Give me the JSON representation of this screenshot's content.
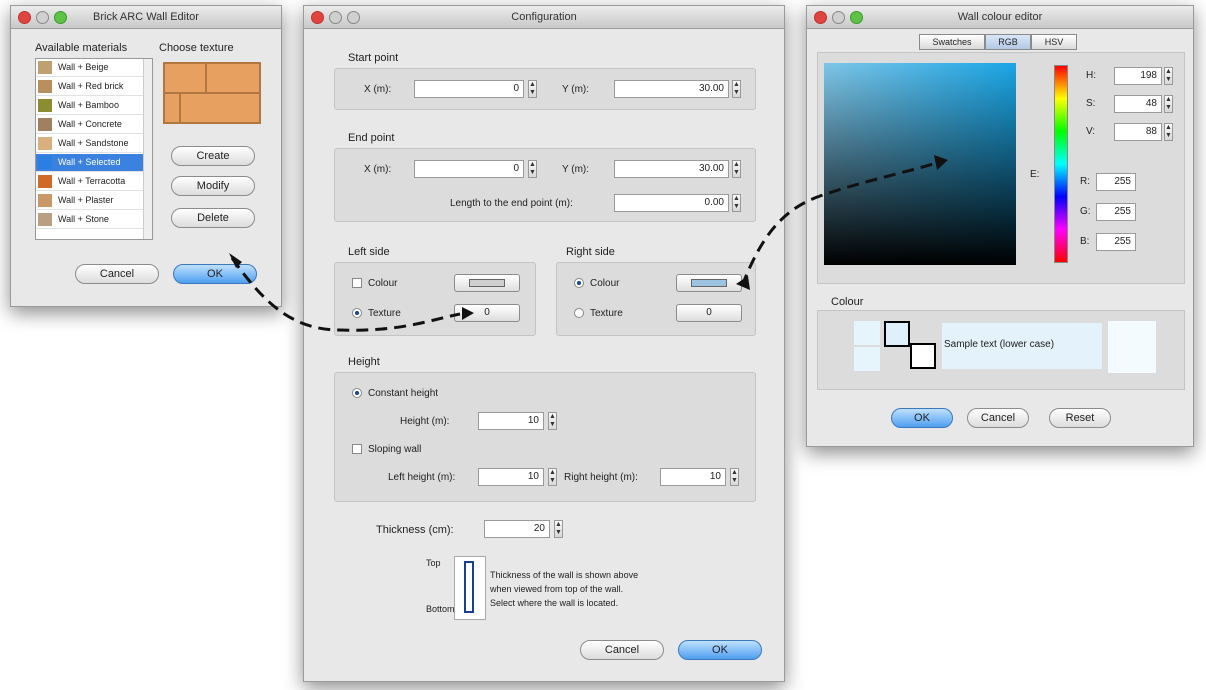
{
  "windows": {
    "left": {
      "title": "Brick ARC Wall Editor",
      "list_header": "Available materials",
      "preview_header": "Choose texture",
      "rows": [
        {
          "label": "Wall + Beige",
          "color": "#c0a070"
        },
        {
          "label": "Wall + Red brick",
          "color": "#b89060"
        },
        {
          "label": "Wall + Bamboo",
          "color": "#8c8c30"
        },
        {
          "label": "Wall + Concrete",
          "color": "#a08060"
        },
        {
          "label": "Wall + Sandstone",
          "color": "#d8b080"
        },
        {
          "label": "Wall + Selected",
          "color": "#2a7fe0"
        },
        {
          "label": "Wall + Terracotta",
          "color": "#d06a28"
        },
        {
          "label": "Wall + Plaster",
          "color": "#c89868"
        },
        {
          "label": "Wall + Stone",
          "color": "#b8a080"
        }
      ],
      "buttons": {
        "create": "Create",
        "modify": "Modify",
        "delete": "Delete",
        "cancel": "Cancel",
        "ok": "OK"
      }
    },
    "middle": {
      "title": "Configuration",
      "start_point": {
        "label": "Start point",
        "x_label": "X (m):",
        "x_value": "0",
        "y_label": "Y (m):",
        "y_value": "30.00"
      },
      "end_point": {
        "label": "End point",
        "x_label": "X (m):",
        "x_value": "0",
        "y_label": "Y (m):",
        "y_value": "30.00",
        "len_label": "Length to the end point (m):",
        "len_value": "0.00"
      },
      "left_side": {
        "label": "Left side",
        "opt1": "Colour",
        "opt2": "Texture",
        "opt2_value": "0"
      },
      "right_side": {
        "label": "Right side",
        "opt1": "Colour",
        "opt2": "Texture",
        "opt2_value": "0"
      },
      "height": {
        "label": "Height",
        "opt1": "Constant height",
        "height_label": "Height (m):",
        "height_value": "10",
        "opt2": "Sloping wall",
        "left_label": "Left height (m):",
        "left_value": "10",
        "right_label": "Right height (m):",
        "right_value": "10"
      },
      "thickness": {
        "label": "Thickness (cm):",
        "value": "20"
      },
      "diagram": {
        "top": "Top",
        "bottom": "Bottom",
        "line1": "Thickness of the wall is shown above",
        "line2": "when viewed from top of the wall.",
        "line3": "Select where the wall is located."
      },
      "buttons": {
        "cancel": "Cancel",
        "ok": "OK"
      }
    },
    "right": {
      "title": "Wall colour editor",
      "tabs": [
        "Swatches",
        "RGB",
        "HSV"
      ],
      "hsv": [
        {
          "label": "H:",
          "value": "198"
        },
        {
          "label": "S:",
          "value": "48"
        },
        {
          "label": "V:",
          "value": "88"
        }
      ],
      "rgb": [
        {
          "label": "R:",
          "value": "255"
        },
        {
          "label": "G:",
          "value": "255"
        },
        {
          "label": "B:",
          "value": "255"
        }
      ],
      "preview_label": "Colour",
      "sample_text": "Sample text (lower case)",
      "buttons": {
        "ok": "OK",
        "cancel": "Cancel",
        "reset": "Reset"
      },
      "colors": {
        "field_top": "#1aa6e6",
        "field_bottom": "#000000"
      }
    }
  }
}
